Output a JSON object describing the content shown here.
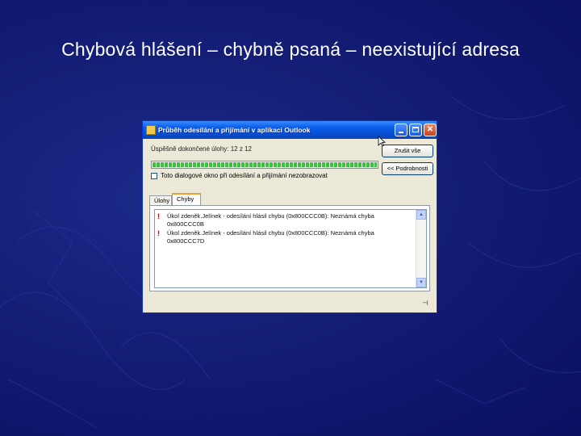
{
  "slide": {
    "title": "Chybová hlášení – chybně psaná – neexistující adresa"
  },
  "window": {
    "title": "Průběh odesílání a přijímání v aplikaci Outlook",
    "status_text": "Úspěšně dokončené úlohy: 12 z 12",
    "progress": 1.0,
    "cancel_button": "Zrušit vše",
    "details_button": "<< Podrobnosti",
    "checkbox_label": "Toto dialogové okno při odesílání a přijímání nezobrazovat",
    "checkbox_checked": false,
    "tabs": [
      {
        "label": "Úlohy"
      },
      {
        "label": "Chyby"
      }
    ],
    "active_tab": "Chyby",
    "errors": [
      {
        "icon": "error-exclamation-icon",
        "text": "Úkol zdeněk.Jelínek - odesílání hlásil chybu (0x800CCC0B): Neznámá chyba 0x800CCC0B"
      },
      {
        "icon": "error-exclamation-icon",
        "text": "Úkol zdeněk.Jelínek - odesílání hlásil chybu (0x800CCC0B): Neznámá chyba 0x800CCC7D"
      }
    ]
  },
  "colors": {
    "background": "#141f78",
    "titlebar": "#0a5ee8",
    "window_face": "#ece9d8",
    "progress": "#3cc23c",
    "error_icon": "#d00000"
  }
}
